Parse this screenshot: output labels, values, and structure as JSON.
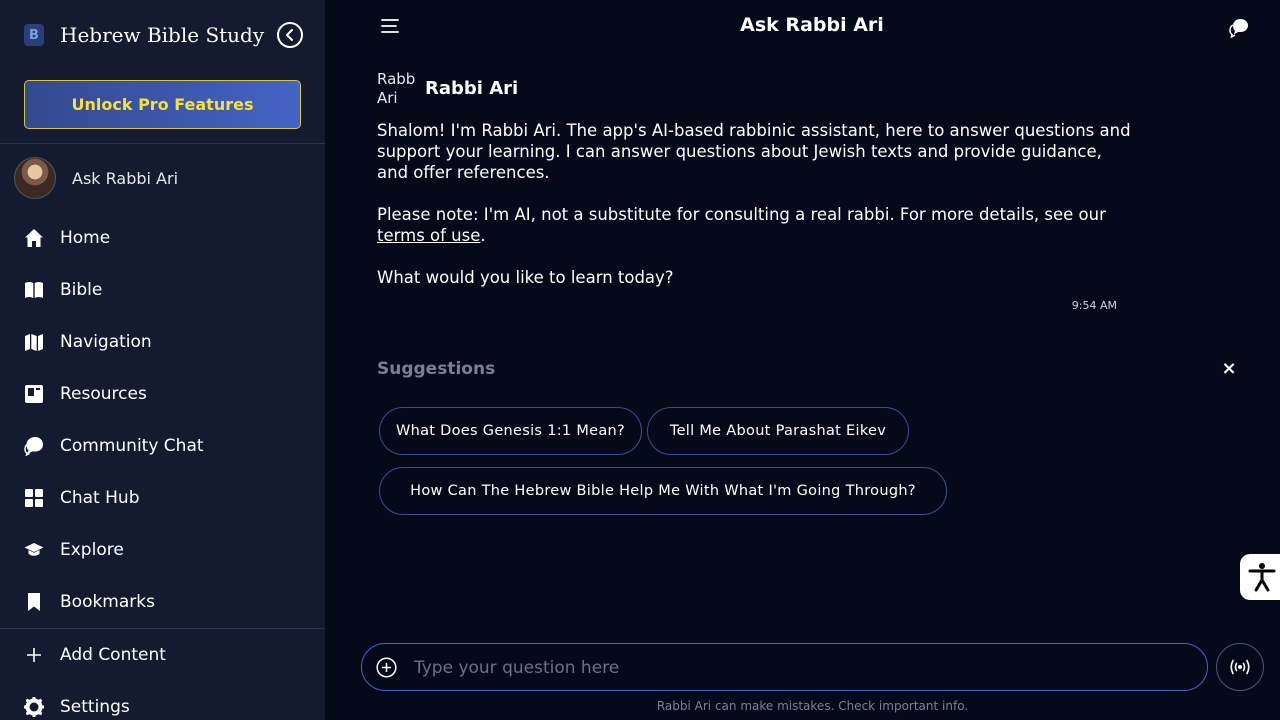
{
  "sidebar": {
    "brand_logo": "B",
    "brand_title": "Hebrew Bible Study",
    "pro_label": "Unlock Pro Features",
    "rabbi_label": "Ask Rabbi Ari",
    "items": [
      {
        "label": "Home",
        "icon": "home-icon"
      },
      {
        "label": "Bible",
        "icon": "book-icon"
      },
      {
        "label": "Navigation",
        "icon": "map-icon"
      },
      {
        "label": "Resources",
        "icon": "resources-icon"
      },
      {
        "label": "Community Chat",
        "icon": "chat-icon"
      },
      {
        "label": "Chat Hub",
        "icon": "grid-icon"
      },
      {
        "label": "Explore",
        "icon": "graduation-cap-icon"
      },
      {
        "label": "Bookmarks",
        "icon": "bookmark-icon"
      }
    ],
    "add_content": "Add Content",
    "settings": "Settings"
  },
  "header": {
    "title": "Ask Rabbi Ari"
  },
  "message": {
    "avatar_alt": "Rabbi Ari",
    "sender": "Rabbi Ari",
    "paragraph1": "Shalom! I'm Rabbi Ari. The app's AI-based rabbinic assistant, here to answer questions and support your learning. I can answer questions about Jewish texts and provide guidance, and offer references.",
    "paragraph2_before": "Please note: I'm AI, not a substitute for consulting a real rabbi. For more details, see our ",
    "paragraph2_link": "terms of use",
    "paragraph2_after": ".",
    "paragraph3": "What would you like to learn today?",
    "time": "9:54 AM"
  },
  "suggestions": {
    "title": "Suggestions",
    "close": "×",
    "chips": [
      "What Does Genesis 1:1 Mean?",
      "Tell Me About Parashat Eikev",
      "How Can The Hebrew Bible Help Me With What I'm Going Through?"
    ]
  },
  "input": {
    "placeholder": "Type your question here",
    "value": ""
  },
  "footer": {
    "disclaimer": "Rabbi Ari can make mistakes. Check important info."
  },
  "colors": {
    "background": "#050a1a",
    "sidebar": "#141b30",
    "accent": "#4363c2",
    "pro_text": "#f7e03c"
  }
}
